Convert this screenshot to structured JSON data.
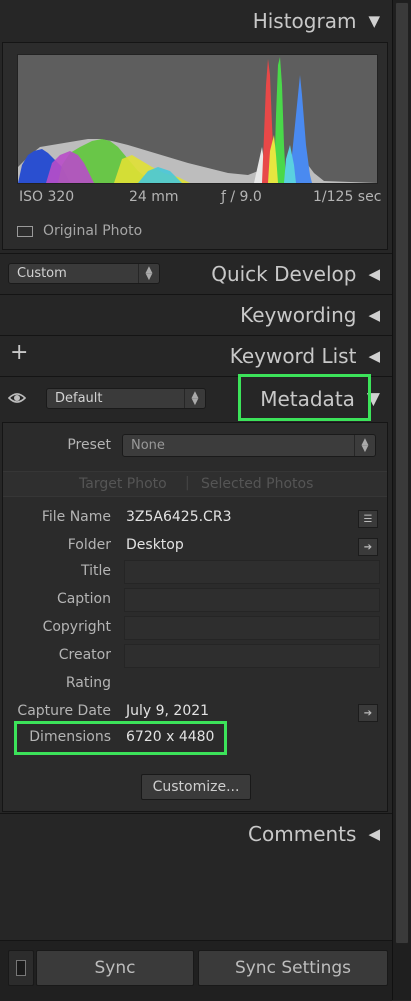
{
  "histogram": {
    "title": "Histogram",
    "iso": "ISO 320",
    "focal": "24 mm",
    "aperture": "ƒ / 9.0",
    "shutter": "1/125 sec",
    "original_photo_label": "Original Photo"
  },
  "quick_develop": {
    "preset_value": "Custom",
    "title": "Quick Develop"
  },
  "keywording": {
    "title": "Keywording"
  },
  "keyword_list": {
    "add_symbol": "+",
    "title": "Keyword List"
  },
  "metadata": {
    "view_value": "Default",
    "title": "Metadata",
    "preset_label": "Preset",
    "preset_value": "None",
    "target_photo": "Target Photo",
    "selected_photos": "Selected Photos",
    "fields": {
      "file_name_label": "File Name",
      "file_name_value": "3Z5A6425.CR3",
      "folder_label": "Folder",
      "folder_value": "Desktop",
      "title_label": "Title",
      "caption_label": "Caption",
      "copyright_label": "Copyright",
      "creator_label": "Creator",
      "rating_label": "Rating",
      "capture_date_label": "Capture Date",
      "capture_date_value": "July 9, 2021",
      "dimensions_label": "Dimensions",
      "dimensions_value": "6720 x 4480"
    },
    "customize_label": "Customize..."
  },
  "comments": {
    "title": "Comments"
  },
  "footer": {
    "sync_label": "Sync",
    "sync_settings_label": "Sync Settings"
  },
  "colors": {
    "highlight": "#3ce35a",
    "panel_bg": "#262626"
  },
  "icons": {
    "collapse": "triangle-left-icon",
    "expand": "triangle-down-icon",
    "eye": "eye-icon"
  }
}
